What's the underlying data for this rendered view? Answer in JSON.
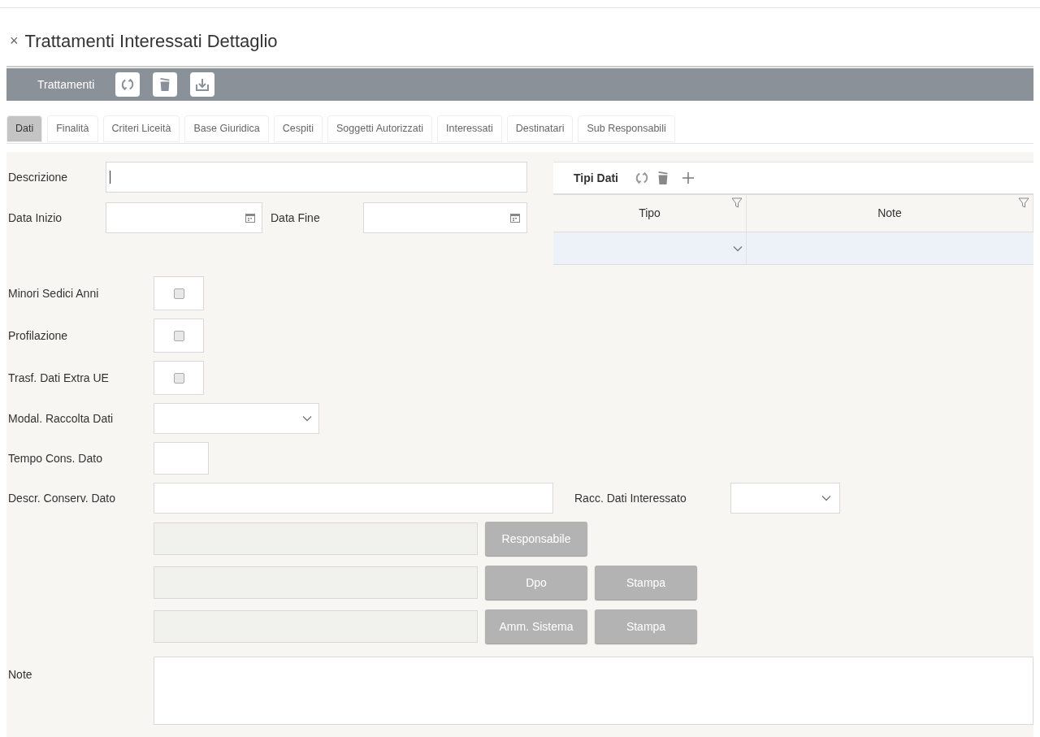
{
  "header": {
    "close": "×",
    "title": "Trattamenti Interessati Dettaglio"
  },
  "toolbar": {
    "label": "Trattamenti"
  },
  "tabs": [
    {
      "label": "Dati",
      "selected": true
    },
    {
      "label": "Finalità",
      "selected": false
    },
    {
      "label": "Criteri Liceità",
      "selected": false
    },
    {
      "label": "Base Giuridica",
      "selected": false
    },
    {
      "label": "Cespiti",
      "selected": false
    },
    {
      "label": "Soggetti Autorizzati",
      "selected": false
    },
    {
      "label": "Interessati",
      "selected": false
    },
    {
      "label": "Destinatari",
      "selected": false
    },
    {
      "label": "Sub Responsabili",
      "selected": false
    }
  ],
  "form": {
    "descrizione": {
      "label": "Descrizione",
      "focused": true
    },
    "data_inizio": {
      "label": "Data Inizio"
    },
    "data_fine": {
      "label": "Data Fine"
    },
    "checkboxes": [
      {
        "label": "Minori Sedici Anni",
        "checked": false
      },
      {
        "label": "Profilazione",
        "checked": false
      },
      {
        "label": "Trasf. Dati Extra UE",
        "checked": false
      }
    ],
    "modal_raccolta": {
      "label": "Modal. Raccolta Dati"
    },
    "tempo_cons": {
      "label": "Tempo Cons. Dato"
    },
    "descr_conserv": {
      "label": "Descr. Conserv. Dato"
    },
    "racc_dati": {
      "label": "Racc. Dati Interessato"
    },
    "persons": [
      {
        "disabled": true,
        "buttons": [
          "Responsabile"
        ]
      },
      {
        "disabled": true,
        "buttons": [
          "Dpo",
          "Stampa"
        ]
      },
      {
        "disabled": true,
        "buttons": [
          "Amm. Sistema",
          "Stampa"
        ]
      }
    ],
    "note": {
      "label": "Note"
    }
  },
  "grid": {
    "title": "Tipi Dati",
    "columns": [
      "Tipo",
      "Note"
    ]
  }
}
